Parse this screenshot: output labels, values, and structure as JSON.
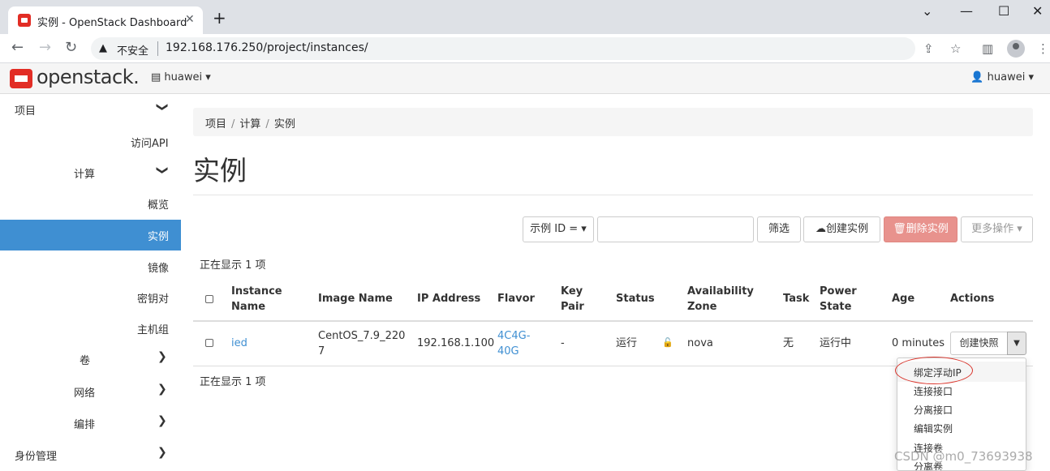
{
  "browser": {
    "tab_title": "实例 - OpenStack Dashboard",
    "insecure_label": "不安全",
    "url": "192.168.176.250/project/instances/"
  },
  "header": {
    "logo_text": "openstack.",
    "project_selector": "huawei ▾",
    "user_menu": "huawei ▾"
  },
  "sidebar": {
    "items": [
      {
        "label": "项目",
        "chevron": "❯"
      },
      {
        "label": "访问API"
      },
      {
        "label": "计算",
        "chevron": "❯"
      },
      {
        "label": "概览"
      },
      {
        "label": "实例"
      },
      {
        "label": "镜像"
      },
      {
        "label": "密钥对"
      },
      {
        "label": "主机组"
      },
      {
        "label": "卷",
        "chevron": "❯"
      },
      {
        "label": "网络",
        "chevron": "❯"
      },
      {
        "label": "编排",
        "chevron": "❯"
      },
      {
        "label": "身份管理",
        "chevron": "❯"
      }
    ]
  },
  "breadcrumb": [
    "项目",
    "计算",
    "实例"
  ],
  "page_title": "实例",
  "actions": {
    "filter_type": "示例 ID = ▾",
    "filter_value": "",
    "filter_button": "筛选",
    "create_button": "创建实例",
    "delete_button": "删除实例",
    "more_button": "更多操作 ▾"
  },
  "count_text": "正在显示 1 项",
  "table": {
    "headers": {
      "instance_name_1": "Instance",
      "instance_name_2": "Name",
      "image_name": "Image Name",
      "ip_address": "IP Address",
      "flavor": "Flavor",
      "key_pair_1": "Key",
      "key_pair_2": "Pair",
      "status": "Status",
      "az_1": "Availability",
      "az_2": "Zone",
      "task": "Task",
      "power_1": "Power",
      "power_2": "State",
      "age": "Age",
      "actions": "Actions"
    },
    "rows": [
      {
        "name": "ied",
        "image_1": "CentOS_7.9_220",
        "image_2": "7",
        "ip": "192.168.1.100",
        "flavor_1": "4C4G-",
        "flavor_2": "40G",
        "key_pair": "-",
        "status": "运行",
        "az": "nova",
        "task": "无",
        "power": "运行中",
        "age": "0 minutes",
        "action": "创建快照"
      }
    ]
  },
  "dropdown": {
    "items": [
      "绑定浮动IP",
      "连接接口",
      "分离接口",
      "编辑实例",
      "连接卷",
      "分离卷"
    ]
  },
  "watermark": "CSDN @m0_73693938",
  "colors": {
    "accent": "#3f8fd2",
    "danger": "#e8928d",
    "brand": "#e22d25"
  }
}
